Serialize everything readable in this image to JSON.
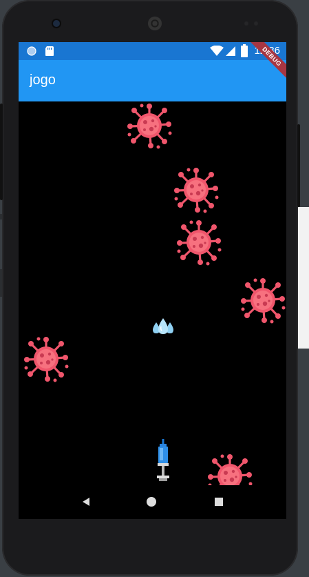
{
  "statusbar": {
    "time": "12:36"
  },
  "appbar": {
    "title": "jogo",
    "debug_label": "DEBUG"
  },
  "game": {
    "viruses": [
      "virus-1",
      "virus-2",
      "virus-3",
      "virus-4",
      "virus-5",
      "virus-6"
    ],
    "projectile": "water-drops",
    "player": "syringe"
  },
  "colors": {
    "statusbar": "#1976d2",
    "appbar": "#2196f3",
    "virus": "#f0566c",
    "game_bg": "#000000"
  },
  "icons": [
    "status-circle-icon",
    "sd-card-icon",
    "wifi-icon",
    "signal-icon",
    "battery-icon",
    "back-icon",
    "home-icon",
    "recents-icon"
  ]
}
